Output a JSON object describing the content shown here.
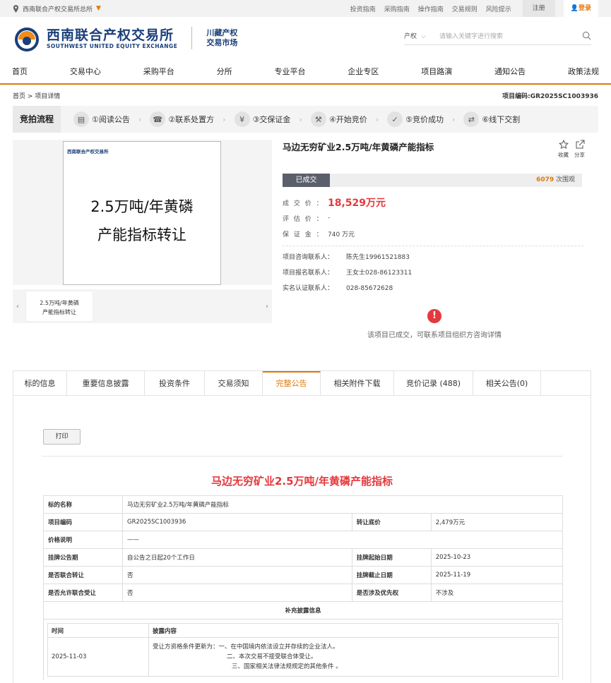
{
  "topbar": {
    "location": "西南联合产权交易所总所",
    "links": [
      "投资指南",
      "采购指南",
      "操作指南",
      "交易规则",
      "风险提示"
    ],
    "register": "注册",
    "login": "登录"
  },
  "header": {
    "logo_cn": "西南联合产权交易所",
    "logo_en": "SOUTHWEST UNITED EQUITY EXCHANGE",
    "sub_line1": "川藏产权",
    "sub_line2": "交易市场",
    "search_select": "产权",
    "search_placeholder": "请输入关键字进行搜索"
  },
  "nav": [
    "首页",
    "交易中心",
    "采购平台",
    "分所",
    "专业平台",
    "企业专区",
    "项目路演",
    "通知公告",
    "政策法规"
  ],
  "breadcrumb": {
    "text": "首页 > 项目详情",
    "code_label": "项目编码:",
    "code": "GR2025SC1003936"
  },
  "flow": {
    "title": "竞拍流程",
    "steps": [
      "①阅读公告",
      "②联系处置方",
      "③交保证金",
      "④开始竞价",
      "⑤竞价成功",
      "⑥线下交割"
    ]
  },
  "image": {
    "mini_logo": "西南联合产权交易所",
    "line1": "2.5万吨/年黄磷",
    "line2": "产能指标转让",
    "thumb_line1": "2.5万吨/年黄磷",
    "thumb_line2": "产能指标转让"
  },
  "project": {
    "title": "马边无穷矿业2.5万吨/年黄磷产能指标",
    "fav": "收藏",
    "share": "分享",
    "status": "已成交",
    "views": "6079",
    "views_suffix": " 次围观",
    "deal_label": "成 交 价 ：",
    "deal_value": "18,529万元",
    "eval_label": "评 估 价 ：",
    "eval_value": "-",
    "deposit_label": "保 证 金 ：",
    "deposit_value": "740 万元",
    "contacts": [
      {
        "label": "项目咨询联系人：",
        "value": "陈先生19961521883"
      },
      {
        "label": "项目报名联系人：",
        "value": "王女士028-86123311"
      },
      {
        "label": "实名认证联系人：",
        "value": "028-85672628"
      }
    ],
    "notice": "该项目已成交，可联系项目组织方咨询详情"
  },
  "tabs": [
    {
      "label": "标的信息",
      "w": 76
    },
    {
      "label": "重要信息披露",
      "w": 110
    },
    {
      "label": "投资条件",
      "w": 85
    },
    {
      "label": "交易须知",
      "w": 82
    },
    {
      "label": "完整公告",
      "w": 82
    },
    {
      "label": "相关附件下载",
      "w": 104
    },
    {
      "label": "竞价记录 (488)",
      "w": 112
    },
    {
      "label": "相关公告(0)",
      "w": 96
    }
  ],
  "announcement": {
    "print": "打印",
    "title": "马边无穷矿业2.5万吨/年黄磷产能指标",
    "name_label": "标的名称",
    "name_value": "马边无穷矿业2.5万吨/年黄磷产能指标",
    "code_label": "项目编码",
    "code_value": "GR2025SC1003936",
    "base_label": "转让底价",
    "base_value": "2,479万元",
    "price_note_label": "价格说明",
    "price_note_value": "——",
    "period_label": "挂牌公告期",
    "period_value": "自公告之日起20个工作日",
    "start_label": "挂牌起始日期",
    "start_value": "2025-10-23",
    "joint_label": "是否联合转让",
    "joint_value": "否",
    "end_label": "挂牌截止日期",
    "end_value": "2025-11-19",
    "joint_acc_label": "是否允许联合受让",
    "joint_acc_value": "否",
    "priority_label": "是否涉及优先权",
    "priority_value": "不涉及",
    "supp_title": "补充披露信息",
    "supp_time_h": "时间",
    "supp_content_h": "披露内容",
    "supp_date": "2025-11-03",
    "supp_line1": "受让方资格条件更新为：一、在中国境内依法设立并存续的企业法人。",
    "supp_line2": "二、本次交易不接受联合体受让。",
    "supp_line3": "三、国家相关法律法规规定的其他条件 。"
  }
}
